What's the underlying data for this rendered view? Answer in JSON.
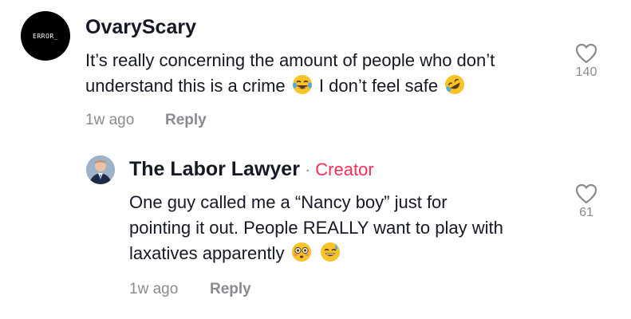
{
  "comments": [
    {
      "avatar_text": "ERROR_",
      "username": "OvaryScary",
      "line1": "It’s really concerning the amount of people who don’t",
      "line2_a": "understand this is a crime",
      "line2_b": "I don’t feel safe",
      "emojis": [
        "face-with-tears-of-joy-icon",
        "rolling-on-floor-laughing-icon"
      ],
      "time": "1w ago",
      "reply_label": "Reply",
      "likes": "140"
    },
    {
      "username": "The Labor Lawyer",
      "separator": "·",
      "badge": "Creator",
      "line1": "One guy called me a “Nancy boy” just for",
      "line2": "pointing it out. People REALLY want to play with",
      "line3": "laxatives apparently",
      "emojis": [
        "flushed-face-icon",
        "grinning-face-with-sweat-icon"
      ],
      "time": "1w ago",
      "reply_label": "Reply",
      "likes": "61"
    }
  ],
  "colors": {
    "creator": "#fe2c55",
    "muted": "#8a8b91",
    "text": "#161823"
  }
}
